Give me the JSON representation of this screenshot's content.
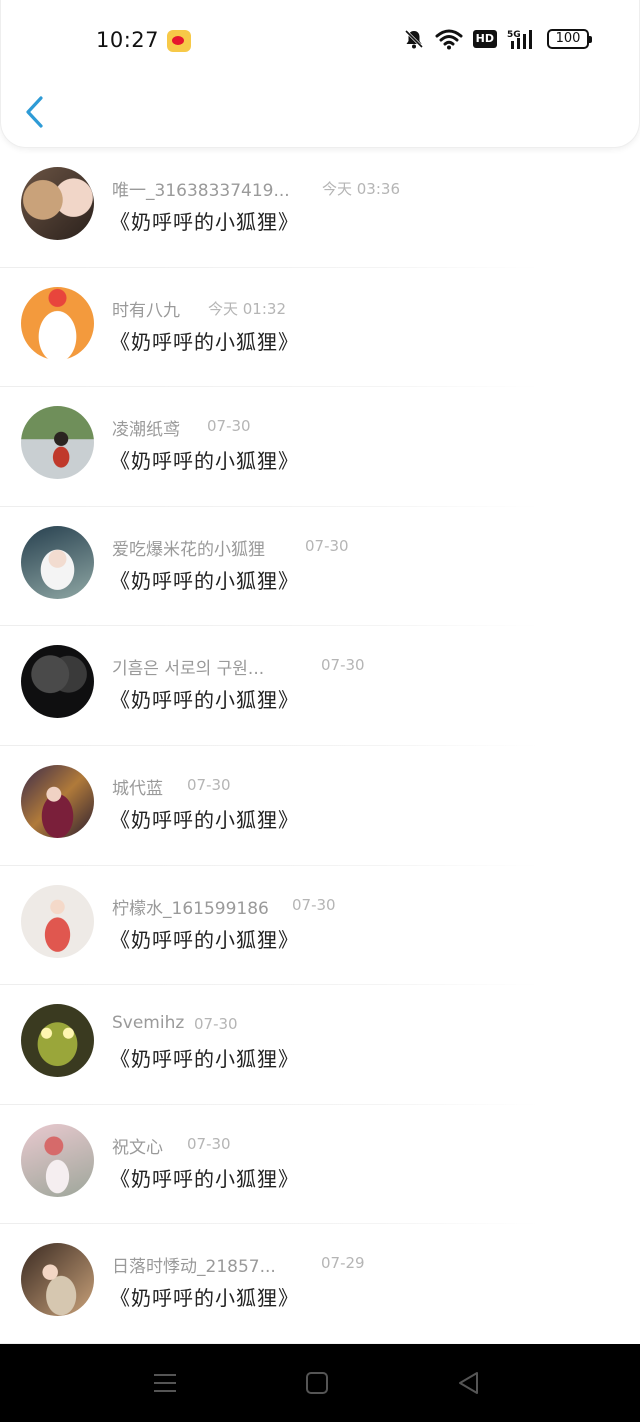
{
  "status_bar": {
    "time": "10:27",
    "hd": "HD",
    "battery": "100",
    "icons": [
      "weibo-icon",
      "mute-bell-icon",
      "wifi-icon",
      "hd-icon",
      "5g-signal-icon",
      "battery-icon"
    ]
  },
  "header": {
    "back_icon": "chevron-left-icon",
    "accent_color": "#2e9bd6"
  },
  "items": [
    {
      "name": "唯一_31638337419...",
      "date": "今天 03:36",
      "message": "《奶呼呼的小狐狸》"
    },
    {
      "name": "时有八九",
      "date": "今天 01:32",
      "message": "《奶呼呼的小狐狸》"
    },
    {
      "name": "凌潮纸鸢",
      "date": "07-30",
      "message": "《奶呼呼的小狐狸》"
    },
    {
      "name": "爱吃爆米花的小狐狸",
      "date": "07-30",
      "message": "《奶呼呼的小狐狸》"
    },
    {
      "name": "기흠은 서로의 구원...",
      "date": "07-30",
      "message": "《奶呼呼的小狐狸》"
    },
    {
      "name": "城代蓝",
      "date": "07-30",
      "message": "《奶呼呼的小狐狸》"
    },
    {
      "name": "柠檬水_161599186",
      "date": "07-30",
      "message": "《奶呼呼的小狐狸》"
    },
    {
      "name": "Svemihz",
      "date": "07-30",
      "message": "《奶呼呼的小狐狸》"
    },
    {
      "name": "祝文心",
      "date": "07-30",
      "message": "《奶呼呼的小狐狸》"
    },
    {
      "name": "日落时悸动_21857...",
      "date": "07-29",
      "message": "《奶呼呼的小狐狸》"
    }
  ],
  "nav_bar": {
    "icons": [
      "menu-icon",
      "home-square-icon",
      "back-triangle-icon"
    ]
  }
}
